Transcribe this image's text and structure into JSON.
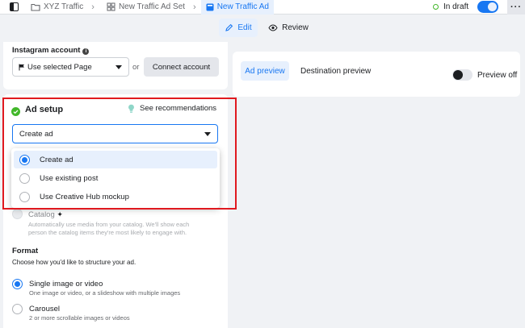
{
  "topbar": {
    "breadcrumbs": [
      {
        "label": "XYZ Traffic",
        "icon": "folder-icon"
      },
      {
        "label": "New Traffic Ad Set",
        "icon": "grid-icon"
      },
      {
        "label": "New Traffic Ad",
        "icon": "ad-square-icon"
      }
    ],
    "status": "In draft",
    "more": "···"
  },
  "tabs": {
    "edit": "Edit",
    "review": "Review"
  },
  "instagram": {
    "label": "Instagram account",
    "select_value": "Use selected Page",
    "or_text": "or",
    "connect_button": "Connect account"
  },
  "ad_setup": {
    "title": "Ad setup",
    "recommendations": "See recommendations",
    "select_value": "Create ad",
    "menu_items": [
      "Create ad",
      "Use existing post",
      "Use Creative Hub mockup"
    ],
    "catalog_label": "Catalog",
    "catalog_desc_1": "Automatically use media from your catalog. We'll show each",
    "catalog_desc_2": "person the catalog items they're most likely to engage with."
  },
  "format": {
    "title": "Format",
    "subtitle": "Choose how you'd like to structure your ad.",
    "options": [
      {
        "label": "Single image or video",
        "desc": "One image or video, or a slideshow with multiple images"
      },
      {
        "label": "Carousel",
        "desc": "2 or more scrollable images or videos"
      }
    ]
  },
  "preview": {
    "tab_ad": "Ad preview",
    "tab_destination": "Destination preview",
    "toggle_label": "Preview off"
  },
  "colors": {
    "accent": "#1877f2",
    "highlight_border": "#e0191f",
    "success": "#42b72a"
  }
}
